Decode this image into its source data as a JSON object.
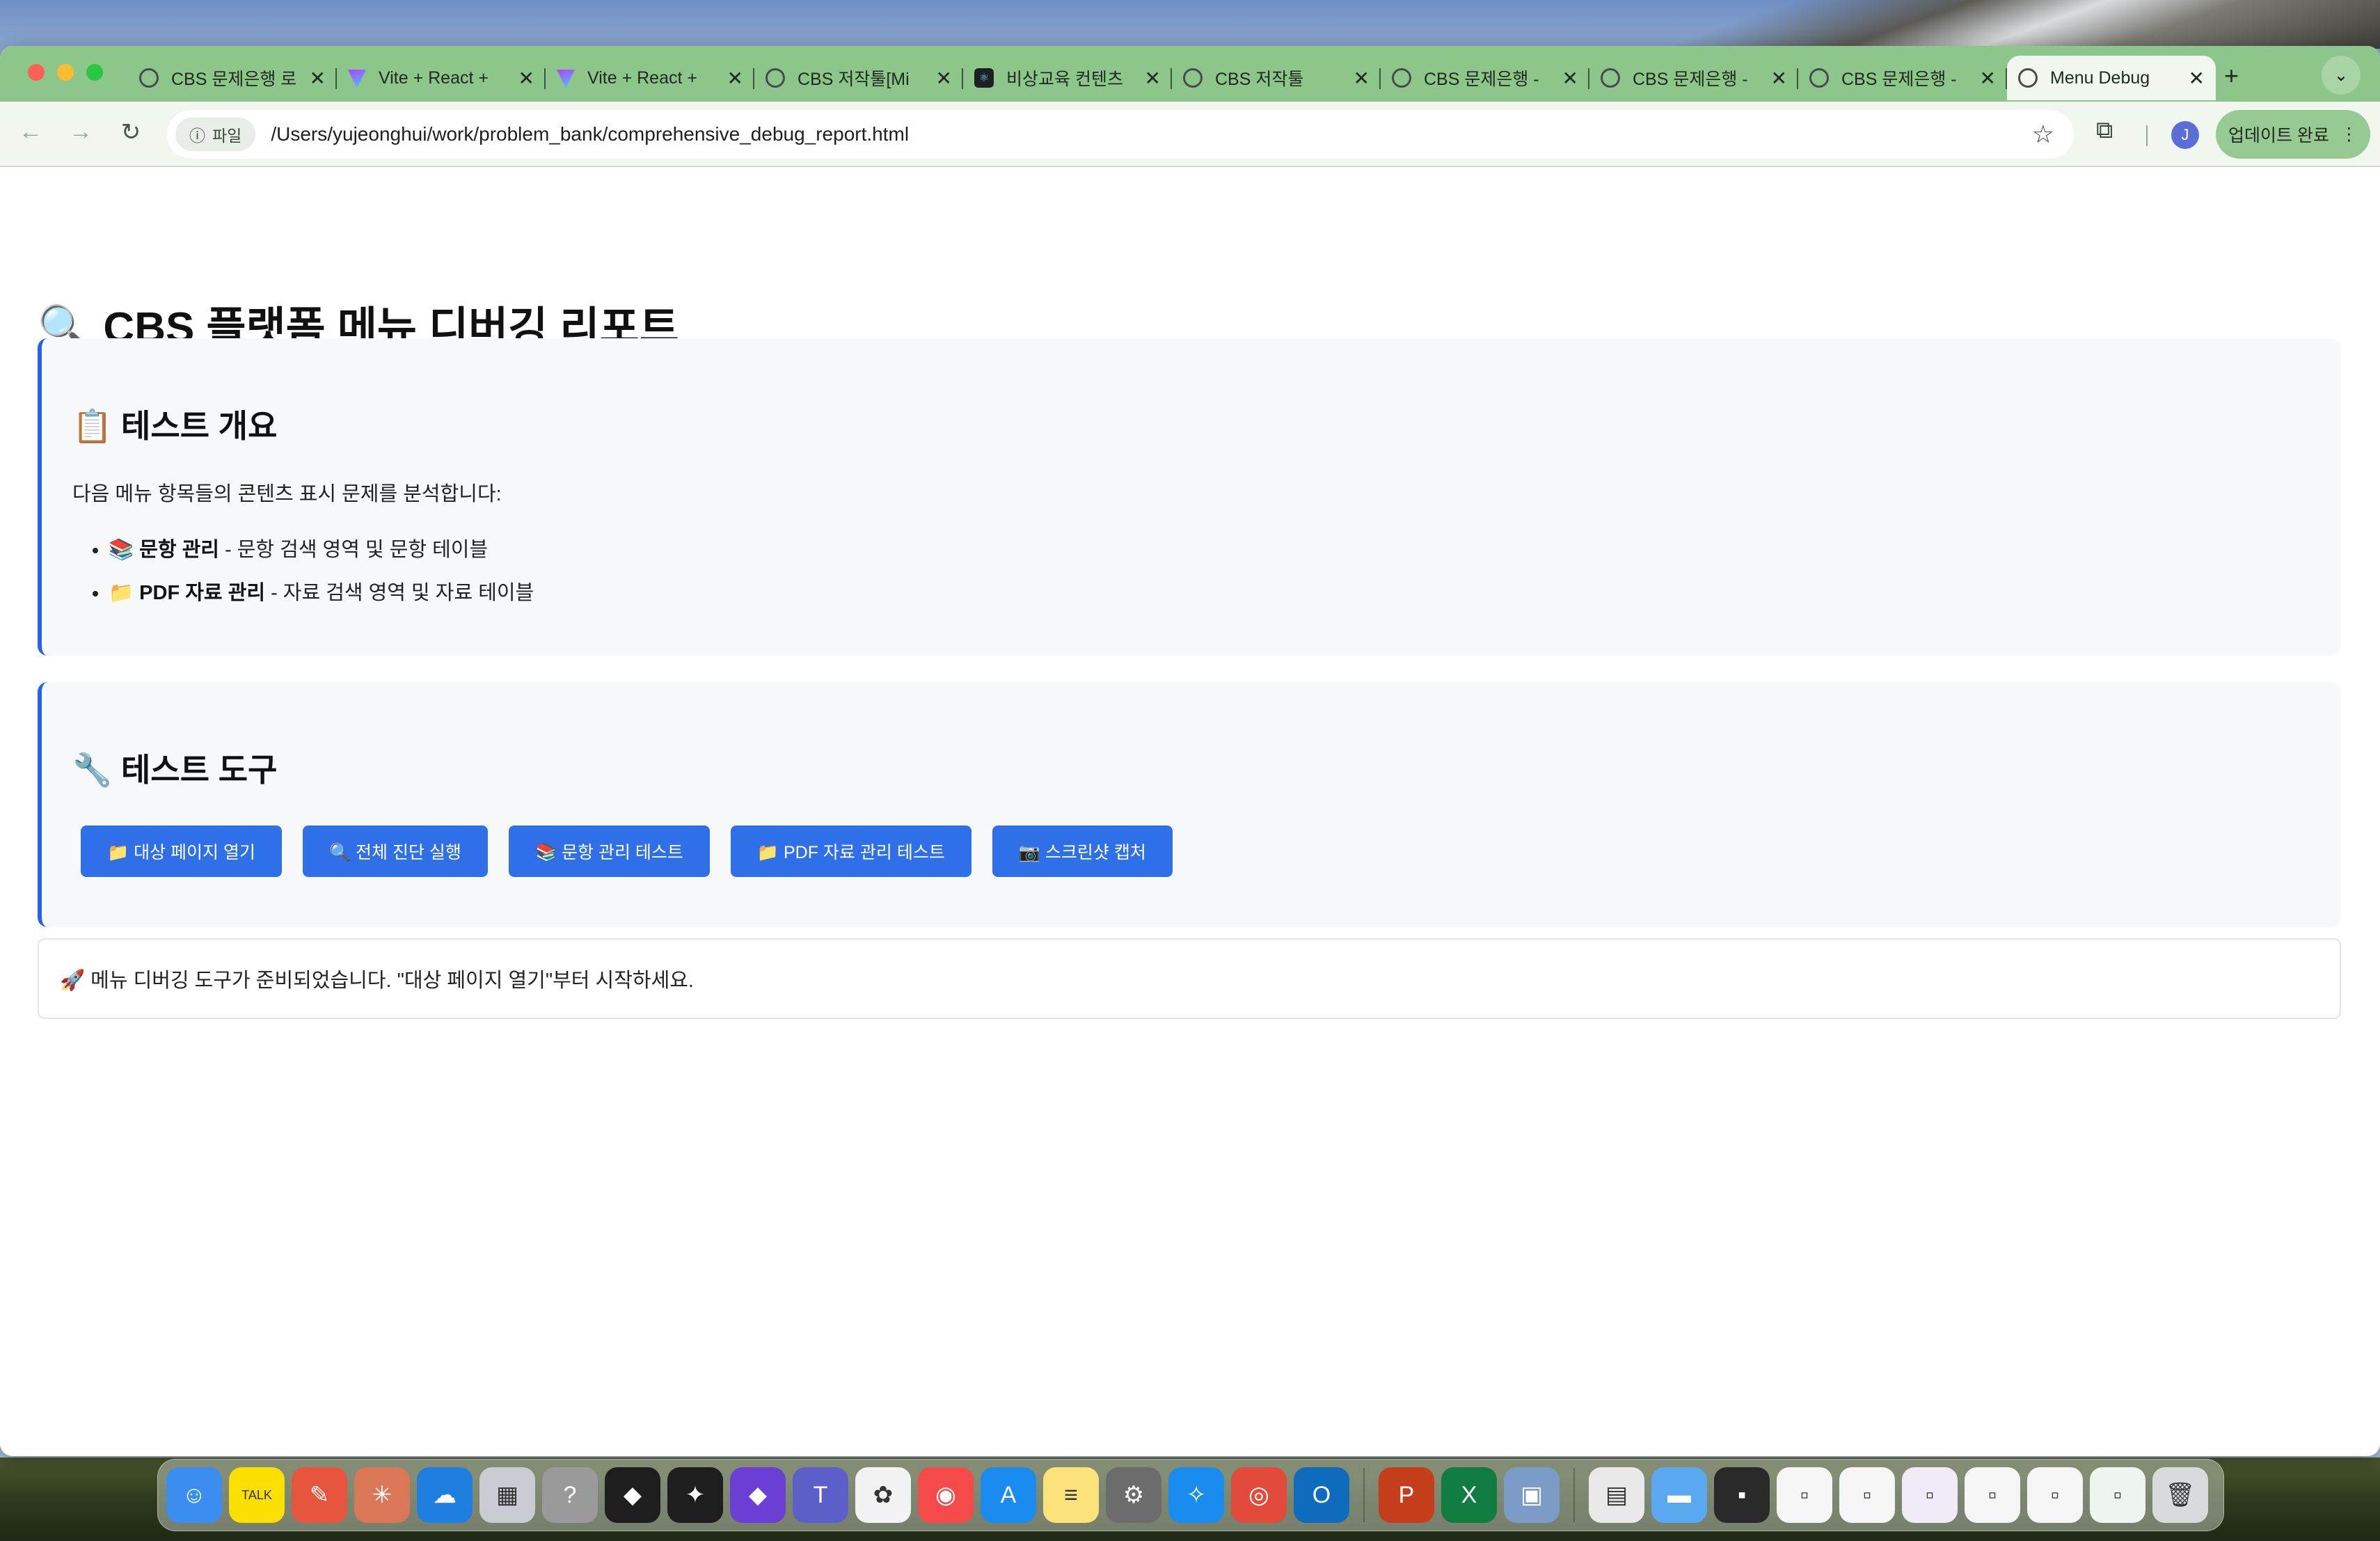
{
  "browser": {
    "tabs": [
      {
        "title": "CBS 문제은행 로",
        "icon": "globe-icon",
        "active": false
      },
      {
        "title": "Vite + React +",
        "icon": "vite-icon",
        "active": false
      },
      {
        "title": "Vite + React +",
        "icon": "vite-icon",
        "active": false
      },
      {
        "title": "CBS 저작툴[Mi",
        "icon": "globe-icon",
        "active": false
      },
      {
        "title": "비상교육 컨텐츠",
        "icon": "react-icon",
        "active": false
      },
      {
        "title": "CBS 저작툴",
        "icon": "globe-icon",
        "active": false
      },
      {
        "title": "CBS 문제은행 -",
        "icon": "globe-icon",
        "active": false
      },
      {
        "title": "CBS 문제은행 -",
        "icon": "globe-icon",
        "active": false
      },
      {
        "title": "CBS 문제은행 -",
        "icon": "globe-icon",
        "active": false
      },
      {
        "title": "Menu Debug",
        "icon": "globe-icon",
        "active": true
      }
    ],
    "close_glyph": "✕",
    "new_tab_glyph": "+",
    "tab_menu_glyph": "⌄",
    "nav": {
      "back": "←",
      "forward": "→",
      "reload": "↻"
    },
    "chip_label": "파일",
    "chip_icon": "ⓘ",
    "url": "/Users/yujeonghui/work/problem_bank/comprehensive_debug_report.html",
    "star_glyph": "☆",
    "extensions_glyph": "⧉",
    "avatar_initial": "J",
    "update_label": "업데이트 완료",
    "update_menu_glyph": "⋮",
    "accent_color": "#8dc68a"
  },
  "page": {
    "title": "🔍 CBS 플랫폼 메뉴 디버깅 리포트",
    "overview": {
      "heading": "📋 테스트 개요",
      "intro": "다음 메뉴 항목들의 콘텐츠 표시 문제를 분석합니다:",
      "items": [
        {
          "icon": "📚",
          "name": "문항 관리",
          "desc": " - 문항 검색 영역 및 문항 테이블"
        },
        {
          "icon": "📁",
          "name": "PDF 자료 관리",
          "desc": " - 자료 검색 영역 및 자료 테이블"
        }
      ]
    },
    "tools": {
      "heading": "🔧 테스트 도구",
      "buttons": [
        "📁 대상 페이지 열기",
        "🔍 전체 진단 실행",
        "📚 문항 관리 테스트",
        "📁 PDF 자료 관리 테스트",
        "📷 스크린샷 캡처"
      ]
    },
    "status": "🚀 메뉴 디버깅 도구가 준비되었습니다. \"대상 페이지 열기\"부터 시작하세요.",
    "button_color": "#2f6fe8",
    "card_border_color": "#2563eb"
  },
  "dock": {
    "apps": [
      {
        "name": "finder-icon",
        "glyph": "☺",
        "color": "#3b8ef0"
      },
      {
        "name": "kakaotalk-icon",
        "glyph": "TALK",
        "color": "#f9e000"
      },
      {
        "name": "pen-app-icon",
        "glyph": "✎",
        "color": "#e8553f"
      },
      {
        "name": "claude-icon",
        "glyph": "✳",
        "color": "#d97757"
      },
      {
        "name": "onedrive-icon",
        "glyph": "☁",
        "color": "#1f7fe0"
      },
      {
        "name": "launchpad-icon",
        "glyph": "▦",
        "color": "#c9ccd2"
      },
      {
        "name": "help-icon",
        "glyph": "?",
        "color": "#9a9a9a"
      },
      {
        "name": "cursor-icon",
        "glyph": "◆",
        "color": "#1e1e1e"
      },
      {
        "name": "figma-icon",
        "glyph": "✦",
        "color": "#1e1e1e"
      },
      {
        "name": "obsidian-icon",
        "glyph": "◆",
        "color": "#6b3fd6"
      },
      {
        "name": "teams-icon",
        "glyph": "T",
        "color": "#5b5fc7"
      },
      {
        "name": "photos-icon",
        "glyph": "✿",
        "color": "#f2f2f2"
      },
      {
        "name": "video-app-icon",
        "glyph": "◉",
        "color": "#f44a4a"
      },
      {
        "name": "app-store-icon",
        "glyph": "A",
        "color": "#1a8cf0"
      },
      {
        "name": "notes-icon",
        "glyph": "≡",
        "color": "#fbe37a"
      },
      {
        "name": "system-settings-icon",
        "glyph": "⚙",
        "color": "#6c6c6c"
      },
      {
        "name": "safari-icon",
        "glyph": "✧",
        "color": "#1a8cf0"
      },
      {
        "name": "chrome-icon",
        "glyph": "◎",
        "color": "#e24a3b"
      },
      {
        "name": "outlook-icon",
        "glyph": "O",
        "color": "#0f6cbd"
      },
      {
        "name": "powerpoint-icon",
        "glyph": "P",
        "color": "#c43e1c"
      },
      {
        "name": "excel-icon",
        "glyph": "X",
        "color": "#107c41"
      },
      {
        "name": "preview-icon",
        "glyph": "▣",
        "color": "#7a9cc6"
      },
      {
        "name": "pdf-file-icon",
        "glyph": "▤",
        "color": "#e9e9e9"
      },
      {
        "name": "folder-icon",
        "glyph": "▬",
        "color": "#5aa9f0"
      },
      {
        "name": "terminal-window-icon",
        "glyph": "▪",
        "color": "#2a2a2a"
      },
      {
        "name": "window-thumb-icon",
        "glyph": "▫",
        "color": "#f5f5f5"
      },
      {
        "name": "window-thumb-icon",
        "glyph": "▫",
        "color": "#f5f5f5"
      },
      {
        "name": "window-thumb-icon",
        "glyph": "▫",
        "color": "#f0ecf7"
      },
      {
        "name": "window-thumb-icon",
        "glyph": "▫",
        "color": "#f5f5f5"
      },
      {
        "name": "window-thumb-icon",
        "glyph": "▫",
        "color": "#f5f5f5"
      },
      {
        "name": "window-thumb-icon",
        "glyph": "▫",
        "color": "#eef5ee"
      },
      {
        "name": "trash-icon",
        "glyph": "🗑",
        "color": "#d9dadc"
      }
    ]
  }
}
